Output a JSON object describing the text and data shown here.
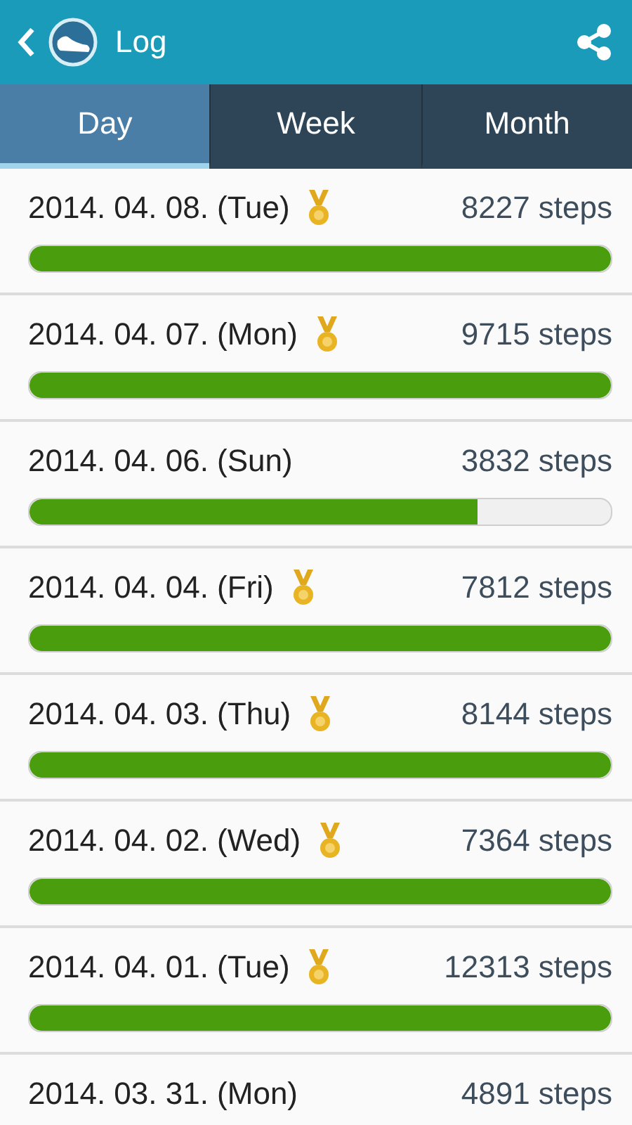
{
  "header": {
    "title": "Log"
  },
  "tabs": [
    {
      "label": "Day",
      "selected": true
    },
    {
      "label": "Week",
      "selected": false
    },
    {
      "label": "Month",
      "selected": false
    }
  ],
  "rows": [
    {
      "date": "2014. 04. 08. (Tue)",
      "medal": true,
      "steps": "8227 steps",
      "level": 1
    },
    {
      "date": "2014. 04. 07. (Mon)",
      "medal": true,
      "steps": "9715 steps",
      "level": 1
    },
    {
      "date": "2014. 04. 06. (Sun)",
      "medal": false,
      "steps": "3832 steps",
      "level": 0.77
    },
    {
      "date": "2014. 04. 04. (Fri)",
      "medal": true,
      "steps": "7812 steps",
      "level": 1
    },
    {
      "date": "2014. 04. 03. (Thu)",
      "medal": true,
      "steps": "8144 steps",
      "level": 1
    },
    {
      "date": "2014. 04. 02. (Wed)",
      "medal": true,
      "steps": "7364 steps",
      "level": 1
    },
    {
      "date": "2014. 04. 01. (Tue)",
      "medal": true,
      "steps": "12313 steps",
      "level": 1
    },
    {
      "date": "2014. 03. 31. (Mon)",
      "medal": false,
      "steps": "4891 steps"
    }
  ]
}
